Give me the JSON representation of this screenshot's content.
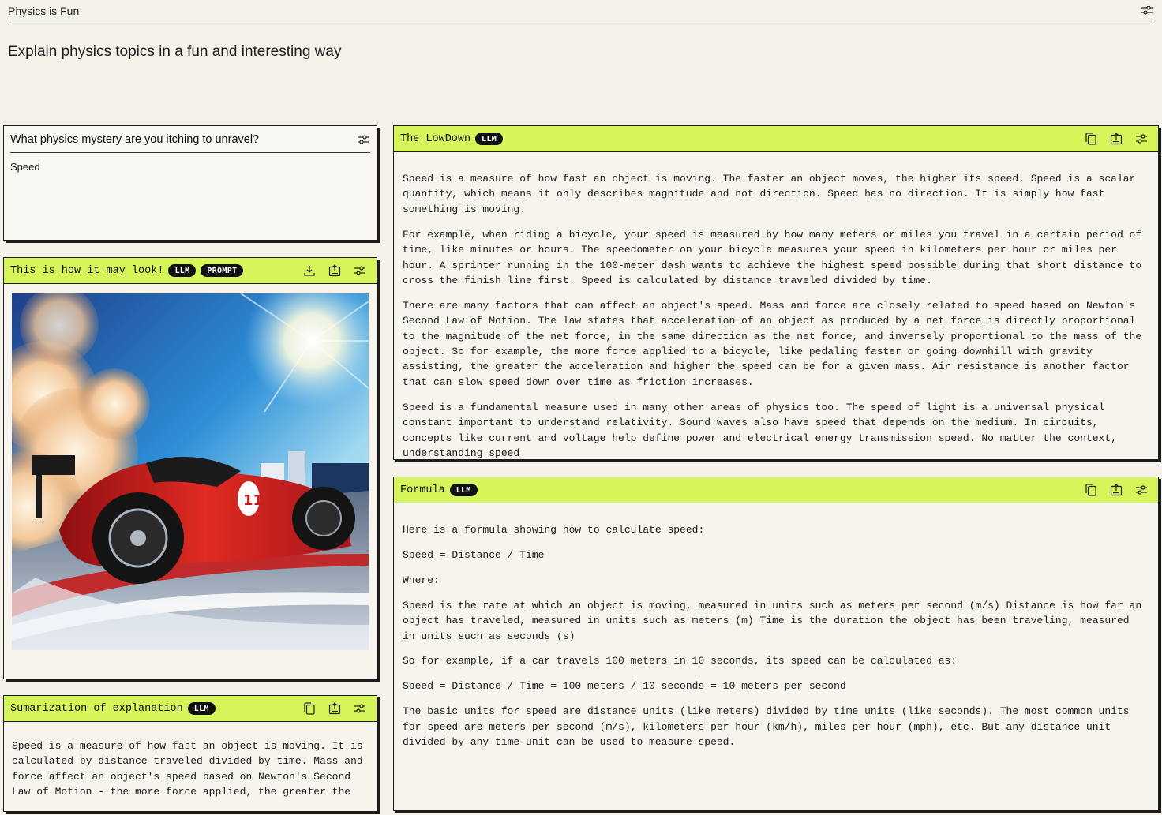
{
  "app": {
    "title": "Physics is Fun",
    "subtitle": "Explain physics topics in a fun and interesting way"
  },
  "badges": {
    "llm": "LLM",
    "prompt": "PROMPT"
  },
  "input_card": {
    "title": "What physics mystery are you itching to unravel?",
    "value": "Speed"
  },
  "image_card": {
    "title": "This is how it may look!"
  },
  "summary_card": {
    "title": "Sumarization of explanation",
    "text": "Speed is a measure of how fast an object is moving. It is calculated by distance traveled divided by time. Mass and force affect an object's speed based on Newton's Second Law of Motion - the more force applied, the greater the"
  },
  "lowdown_card": {
    "title": "The LowDown",
    "paragraphs": [
      "Speed is a measure of how fast an object is moving. The faster an object moves, the higher its speed. Speed is a scalar quantity, which means it only describes magnitude and not direction. Speed has no direction. It is simply how fast something is moving.",
      "For example, when riding a bicycle, your speed is measured by how many meters or miles you travel in a certain period of time, like minutes or hours. The speedometer on your bicycle measures your speed in kilometers per hour or miles per hour. A sprinter running in the 100-meter dash wants to achieve the highest speed possible during that short distance to cross the finish line first. Speed is calculated by distance traveled divided by time.",
      "There are many factors that can affect an object's speed. Mass and force are closely related to speed based on Newton's Second Law of Motion. The law states that acceleration of an object as produced by a net force is directly proportional to the magnitude of the net force, in the same direction as the net force, and inversely proportional to the mass of the object. So for example, the more force applied to a bicycle, like pedaling faster or going downhill with gravity assisting, the greater the acceleration and higher the speed can be for a given mass. Air resistance is another factor that can slow speed down over time as friction increases.",
      "Speed is a fundamental measure used in many other areas of physics too. The speed of light is a universal physical constant important to understand relativity. Sound waves also have speed that depends on the medium. In circuits, concepts like current and voltage help define power and electrical energy transmission speed. No matter the context, understanding speed"
    ]
  },
  "formula_card": {
    "title": "Formula",
    "paragraphs": [
      "Here is a formula showing how to calculate speed:",
      "Speed = Distance / Time",
      "Where:",
      "Speed is the rate at which an object is moving, measured in units such as meters per second (m/s) Distance is how far an object has traveled, measured in units such as meters (m) Time is the duration the object has been traveling, measured in units such as seconds (s)",
      "So for example, if a car travels 100 meters in 10 seconds, its speed can be calculated as:",
      "Speed = Distance / Time = 100 meters / 10 seconds = 10 meters per second",
      "The basic units for speed are distance units (like meters) divided by time units (like seconds). The most common units for speed are meters per second (m/s), kilometers per hour (km/h), miles per hour (mph), etc. But any distance unit divided by any time unit can be used to measure speed."
    ]
  },
  "colors": {
    "accent": "#d6f55a",
    "background": "#f3f1e8",
    "ink": "#1c1c1c"
  },
  "icons": [
    "settings-sliders-icon",
    "copy-icon",
    "share-icon",
    "download-icon"
  ]
}
